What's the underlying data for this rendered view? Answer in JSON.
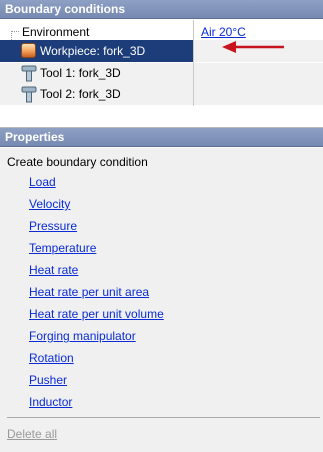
{
  "boundary_conditions": {
    "header": "Boundary conditions",
    "tree": {
      "environment": {
        "label": "Environment",
        "value": "Air 20°C"
      },
      "workpiece": {
        "label": "Workpiece: fork_3D",
        "icon": "workpiece-icon"
      },
      "tool1": {
        "label": "Tool 1: fork_3D",
        "icon": "tool-icon"
      },
      "tool2": {
        "label": "Tool 2: fork_3D",
        "icon": "tool-icon"
      }
    },
    "annotation_arrow_color": "#c8141e",
    "selection_color": "#1c3d7a"
  },
  "properties": {
    "header": "Properties",
    "title": "Create boundary condition",
    "links": [
      "Load",
      "Velocity",
      "Pressure",
      "Temperature",
      "Heat rate",
      "Heat rate per unit area",
      "Heat rate per unit volume",
      "Forging manipulator",
      "Rotation",
      "Pusher",
      "Inductor"
    ],
    "delete_all": "Delete all"
  }
}
